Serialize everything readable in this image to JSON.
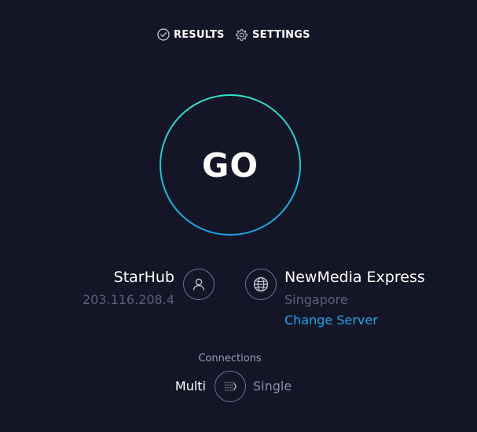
{
  "nav": {
    "results_label": "RESULTS",
    "results_icon": "check-circle-icon",
    "settings_label": "SETTINGS",
    "settings_icon": "gear-icon"
  },
  "go_button": {
    "label": "GO",
    "ring_gradient": [
      "#2ee6c9",
      "#1aa3e8"
    ]
  },
  "isp": {
    "name": "StarHub",
    "ip": "203.116.208.4",
    "icon": "user-icon"
  },
  "server": {
    "name": "NewMedia Express",
    "location": "Singapore",
    "change_label": "Change Server",
    "icon": "globe-icon"
  },
  "connections": {
    "label": "Connections",
    "multi_label": "Multi",
    "single_label": "Single",
    "selected": "Multi",
    "toggle_icon": "connections-toggle-icon"
  },
  "colors": {
    "background": "#141526",
    "accent_link": "#1ca7ec",
    "muted_text": "#5d6079"
  }
}
